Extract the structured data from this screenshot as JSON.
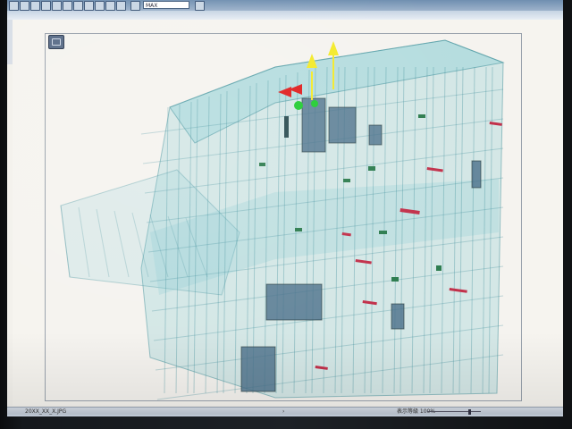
{
  "app": {
    "toolbar_field": "MAX"
  },
  "status": {
    "file": "20XX_XX_X.JPG",
    "mid": "›",
    "zoom_label": "表示等級 100%"
  },
  "colors": {
    "structure": "#7fcad0",
    "structure_dark": "#3f8f9a",
    "equipment": "#4a6f8a",
    "pipe_red": "#c2304a",
    "pipe_green": "#2e7d4f",
    "gizmo_yellow": "#f4ea2a",
    "gizmo_red": "#e02020",
    "gizmo_green": "#22cc33"
  },
  "icons": {
    "view_cube": "view-cube-icon",
    "gizmo": "move-gizmo-icon"
  }
}
